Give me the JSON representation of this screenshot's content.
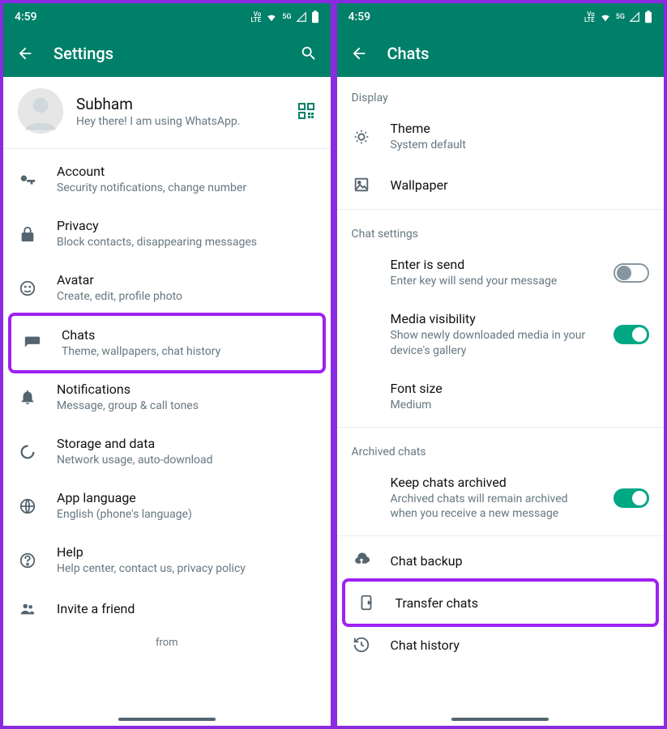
{
  "statusbar": {
    "time": "4:59",
    "net": "5G",
    "volte": "Vo\nLTE"
  },
  "left": {
    "appbar": {
      "title": "Settings"
    },
    "profile": {
      "name": "Subham",
      "status": "Hey there! I am using WhatsApp."
    },
    "items": [
      {
        "title": "Account",
        "sub": "Security notifications, change number"
      },
      {
        "title": "Privacy",
        "sub": "Block contacts, disappearing messages"
      },
      {
        "title": "Avatar",
        "sub": "Create, edit, profile photo"
      },
      {
        "title": "Chats",
        "sub": "Theme, wallpapers, chat history"
      },
      {
        "title": "Notifications",
        "sub": "Message, group & call tones"
      },
      {
        "title": "Storage and data",
        "sub": "Network usage, auto-download"
      },
      {
        "title": "App language",
        "sub": "English (phone's language)"
      },
      {
        "title": "Help",
        "sub": "Help center, contact us, privacy policy"
      },
      {
        "title": "Invite a friend"
      }
    ],
    "from": "from"
  },
  "right": {
    "appbar": {
      "title": "Chats"
    },
    "sectionDisplay": "Display",
    "theme": {
      "title": "Theme",
      "sub": "System default"
    },
    "wallpaper": {
      "title": "Wallpaper"
    },
    "sectionChatSettings": "Chat settings",
    "enterSend": {
      "title": "Enter is send",
      "sub": "Enter key will send your message",
      "on": false
    },
    "mediaVis": {
      "title": "Media visibility",
      "sub": "Show newly downloaded media in your device's gallery",
      "on": true
    },
    "fontSize": {
      "title": "Font size",
      "sub": "Medium"
    },
    "sectionArchived": "Archived chats",
    "keepArchived": {
      "title": "Keep chats archived",
      "sub": "Archived chats will remain archived when you receive a new message",
      "on": true
    },
    "backup": {
      "title": "Chat backup"
    },
    "transfer": {
      "title": "Transfer chats"
    },
    "history": {
      "title": "Chat history"
    }
  }
}
